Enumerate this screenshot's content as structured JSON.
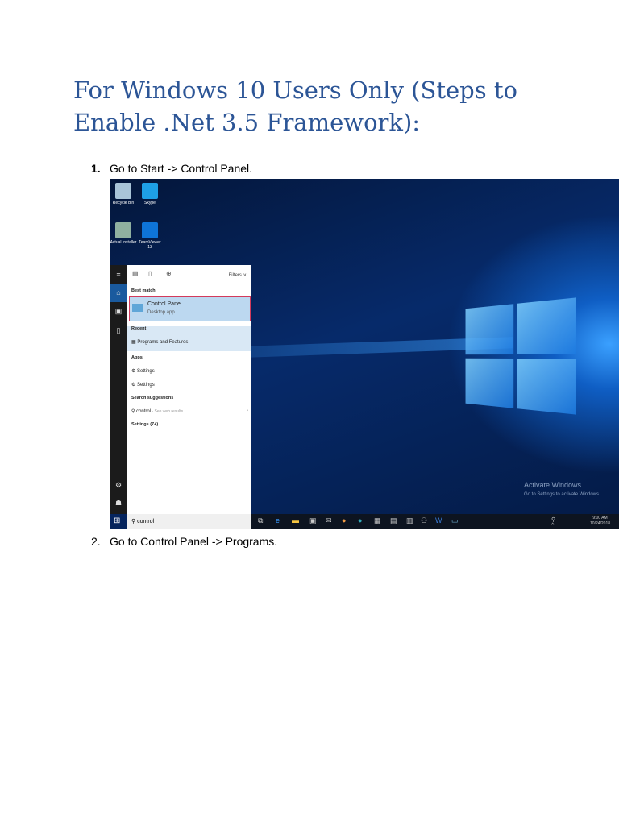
{
  "title": "For Windows 10 Users Only (Steps to Enable .Net 3.5 Framework):",
  "steps": [
    {
      "num": "1.",
      "text": "Go to Start -> Control Panel."
    },
    {
      "num": "2.",
      "text": "Go to Control Panel -> Programs."
    }
  ],
  "screenshot": {
    "desktop_icons": [
      "Recycle Bin",
      "Skype",
      "Actual Installer",
      "TeamViewer 13"
    ],
    "filters": "Filters",
    "best_match": "Best match",
    "best_item": "Control Panel",
    "best_sub": "Desktop app",
    "recent": "Recent",
    "recent_item": "Programs and Features",
    "apps": "Apps",
    "app1": "Settings",
    "app2": "Settings",
    "suggestions": "Search suggestions",
    "sugg_item": "control",
    "sugg_hint": " - See web results",
    "settings_more": "Settings (7+)",
    "search_value": "control",
    "activate_title": "Activate Windows",
    "activate_sub": "Go to Settings to activate Windows.",
    "time": "9:00 AM",
    "date": "10/24/2018"
  }
}
